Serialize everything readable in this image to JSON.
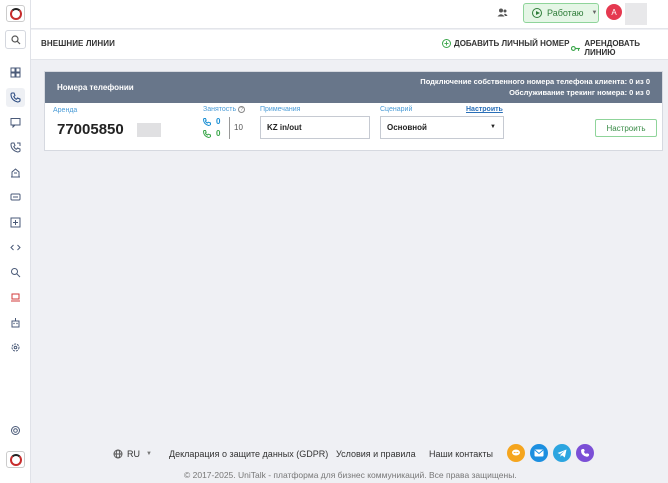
{
  "topbar": {
    "status_label": "Работаю",
    "avatar_letter": "A"
  },
  "page": {
    "title": "ВНЕШНИЕ ЛИНИИ",
    "add_button": "ДОБАВИТЬ ЛИЧНЫЙ НОМЕР",
    "rent_button": "АРЕНДОВАТЬ ЛИНИЮ"
  },
  "card": {
    "title": "Номера телефонии",
    "stat_own": "Подключение собственного номера телефона клиента: 0 из 0",
    "stat_tracking": "Обслуживание трекинг номера: 0 из 0",
    "row": {
      "type_label": "Аренда",
      "phone": "77005850",
      "busy_label": "Занятость",
      "busy_incoming": "0",
      "busy_outgoing": "0",
      "busy_total": "10",
      "notes_label": "Примечания",
      "notes_value": "KZ in/out",
      "scenario_label": "Сценарий",
      "scenario_setup_link": "Настроить",
      "scenario_value": "Основной",
      "setup_button": "Настроить"
    }
  },
  "footer": {
    "lang": "RU",
    "link_gdpr": "Декларация о защите данных (GDPR)",
    "link_terms": "Условия и правила",
    "link_contacts": "Наши контакты",
    "copyright": "© 2017-2025. UniTalk - платформа для бизнес коммуникаций. Все права защищены."
  },
  "colors": {
    "accent_green": "#3aa64a",
    "card_header": "#68768a",
    "link_blue": "#4a9bd6",
    "avatar_red": "#e53950"
  }
}
